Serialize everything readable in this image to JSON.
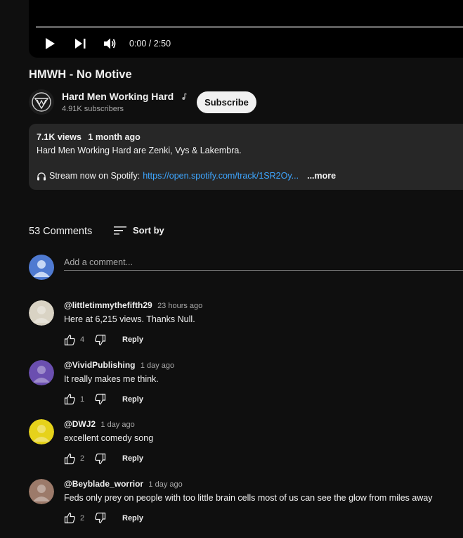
{
  "player": {
    "time": "0:00 / 2:50",
    "play_icon": "play-icon",
    "next_icon": "next-icon",
    "volume_icon": "volume-icon"
  },
  "video": {
    "title": "HMWH - No Motive"
  },
  "channel": {
    "name": "Hard Men Working Hard",
    "badge_icon": "music-note-icon",
    "subscribers": "4.91K subscribers",
    "subscribe_label": "Subscribe"
  },
  "description": {
    "views": "7.1K views",
    "age": "1 month ago",
    "line1": "Hard Men Working Hard are Zenki, Vys & Lakembra.",
    "stream_prefix": "Stream now on Spotify:",
    "stream_link": "https://open.spotify.com/track/1SR2Oy...",
    "more_label": "...more"
  },
  "comments_section": {
    "count_label": "53 Comments",
    "sort_label": "Sort by",
    "add_placeholder": "Add a comment...",
    "reply_label": "Reply",
    "items": [
      {
        "author": "@littletimmythefifth29",
        "time": "23 hours ago",
        "text": "Here at 6,215 views. Thanks Null.",
        "likes": "4",
        "avatar_color": "#d9d3c4"
      },
      {
        "author": "@VividPublishing",
        "time": "1 day ago",
        "text": "It really makes me think.",
        "likes": "1",
        "avatar_color": "#6b4fb0"
      },
      {
        "author": "@DWJ2",
        "time": "1 day ago",
        "text": "excellent comedy song",
        "likes": "2",
        "avatar_color": "#e6d21a"
      },
      {
        "author": "@Beyblade_worrior",
        "time": "1 day ago",
        "text": "Feds only prey on people with too little brain cells most of us can see the glow from miles away",
        "likes": "2",
        "avatar_color": "#9c7a6a"
      }
    ]
  },
  "colors": {
    "background": "#0f0f0f",
    "surface": "#272727",
    "link": "#3ea6ff",
    "my_avatar": "#4f7ad1"
  }
}
